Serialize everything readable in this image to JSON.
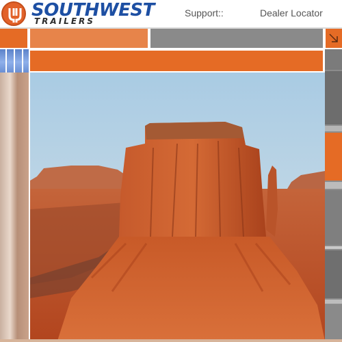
{
  "brand": {
    "name": "SOUTHWEST",
    "sub": "TRAILERS"
  },
  "nav": {
    "support_label": "Support::",
    "dealer_locator_label": "Dealer Locator"
  },
  "colors": {
    "accent_orange": "#e56b25",
    "brand_blue": "#1d4fa3",
    "nav_grey": "#8a8a8a"
  },
  "hero": {
    "icon": "desert-butte-photo"
  },
  "side_icon": "arrow-icon"
}
